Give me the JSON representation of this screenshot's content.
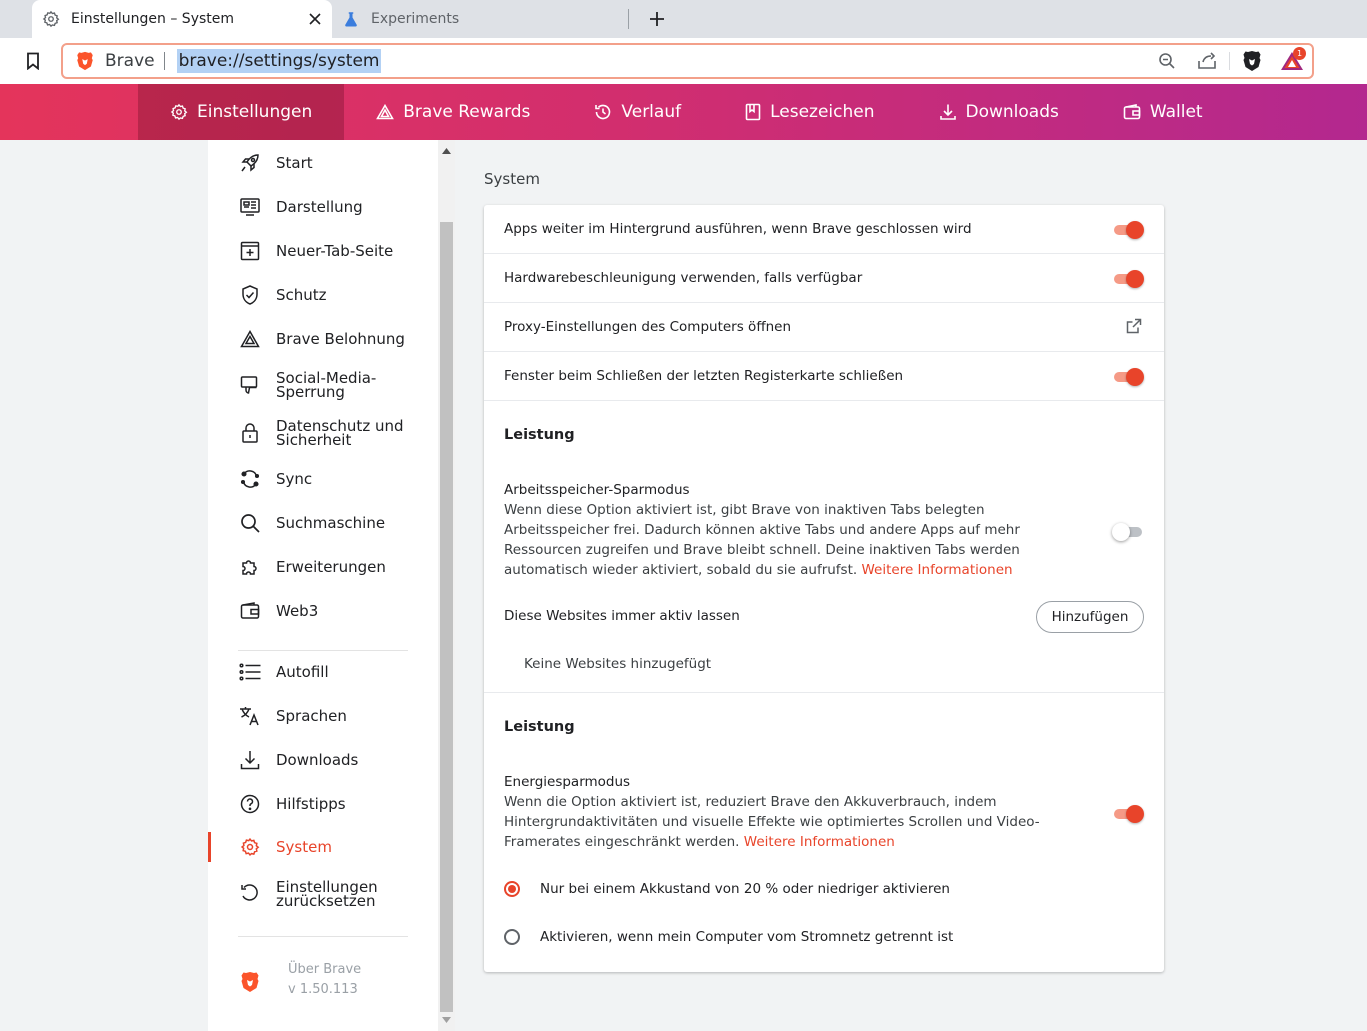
{
  "tabs": [
    {
      "label": "Einstellungen – System",
      "icon": "gear-icon",
      "active": true
    },
    {
      "label": "Experiments",
      "icon": "flask-icon",
      "active": false
    }
  ],
  "toolbar": {
    "brand_label": "Brave",
    "url": "brave://settings/system",
    "rewards_count": "1"
  },
  "nav": {
    "items": [
      {
        "label": "Einstellungen",
        "icon": "gear-icon"
      },
      {
        "label": "Brave Rewards",
        "icon": "triangle-icon"
      },
      {
        "label": "Verlauf",
        "icon": "history-icon"
      },
      {
        "label": "Lesezeichen",
        "icon": "bookmark-icon"
      },
      {
        "label": "Downloads",
        "icon": "download-icon"
      },
      {
        "label": "Wallet",
        "icon": "wallet-icon"
      }
    ]
  },
  "sidebar": {
    "items": [
      {
        "label": "Start",
        "icon": "rocket-icon"
      },
      {
        "label": "Darstellung",
        "icon": "appearance-icon"
      },
      {
        "label": "Neuer-Tab-Seite",
        "icon": "new-tab-icon"
      },
      {
        "label": "Schutz",
        "icon": "shield-icon"
      },
      {
        "label": "Brave Belohnung",
        "icon": "triangle-icon"
      },
      {
        "label": "Social-Media-\nSperrung",
        "icon": "thumbs-down-icon"
      },
      {
        "label": "Datenschutz und\nSicherheit",
        "icon": "lock-icon"
      },
      {
        "label": "Sync",
        "icon": "sync-icon"
      },
      {
        "label": "Suchmaschine",
        "icon": "search-icon"
      },
      {
        "label": "Erweiterungen",
        "icon": "puzzle-icon"
      },
      {
        "label": "Web3",
        "icon": "wallet-icon"
      },
      {
        "label": "Autofill",
        "icon": "list-icon"
      },
      {
        "label": "Sprachen",
        "icon": "translate-icon"
      },
      {
        "label": "Downloads",
        "icon": "download-icon"
      },
      {
        "label": "Hilfstipps",
        "icon": "help-icon"
      },
      {
        "label": "System",
        "icon": "gear-icon",
        "selected": true
      },
      {
        "label": "Einstellungen\nzurücksetzen",
        "icon": "reset-icon"
      }
    ],
    "about_name": "Über Brave",
    "about_version": "v 1.50.113"
  },
  "main": {
    "section_title": "System",
    "rows": [
      {
        "label": "Apps weiter im Hintergrund ausführen, wenn Brave geschlossen wird",
        "control": "toggle",
        "on": true
      },
      {
        "label": "Hardwarebeschleunigung verwenden, falls verfügbar",
        "control": "toggle",
        "on": true
      },
      {
        "label": "Proxy-Einstellungen des Computers öffnen",
        "control": "external-link"
      },
      {
        "label": "Fenster beim Schließen der letzten Registerkarte schließen",
        "control": "toggle",
        "on": true
      }
    ],
    "memory": {
      "heading": "Leistung",
      "title": "Arbeitsspeicher-Sparmodus",
      "desc": "Wenn diese Option aktiviert ist, gibt Brave von inaktiven Tabs belegten Arbeitsspeicher frei. Dadurch können aktive Tabs und andere Apps auf mehr Ressourcen zugreifen und Brave bleibt schnell. Deine inaktiven Tabs werden automatisch wieder aktiviert, sobald du sie aufrufst.",
      "link": "Weitere Informationen",
      "toggle_on": false,
      "sites_label": "Diese Websites immer aktiv lassen",
      "add_button": "Hinzufügen",
      "empty_text": "Keine Websites hinzugefügt"
    },
    "energy": {
      "heading": "Leistung",
      "title": "Energiesparmodus",
      "desc": "Wenn die Option aktiviert ist, reduziert Brave den Akkuverbrauch, indem Hintergrundaktivitäten und visuelle Effekte wie optimiertes Scrollen und Video-Framerates eingeschränkt werden.",
      "link": "Weitere Informationen",
      "toggle_on": true,
      "options": [
        {
          "label": "Nur bei einem Akkustand von 20 % oder niedriger aktivieren",
          "selected": true
        },
        {
          "label": "Aktivieren, wenn mein Computer vom Stromnetz getrennt ist",
          "selected": false
        }
      ]
    }
  },
  "colors": {
    "accent": "#e8442a",
    "nav_start": "#e4345b",
    "nav_end": "#b3288f"
  }
}
